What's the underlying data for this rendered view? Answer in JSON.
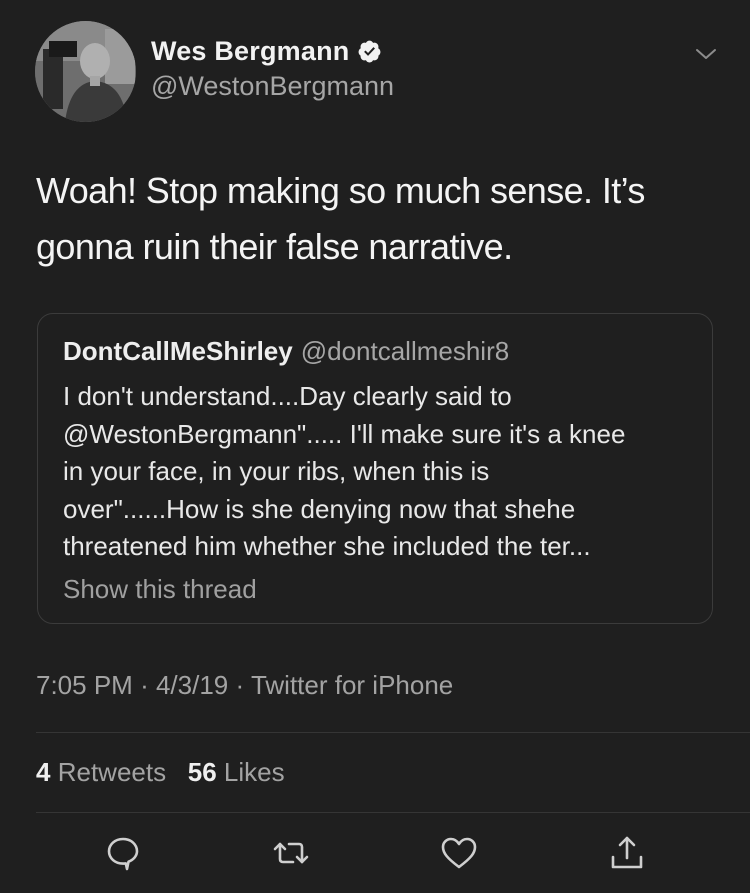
{
  "author": {
    "display_name": "Wes Bergmann",
    "handle": "@WestonBergmann",
    "verified_icon": "verified-badge-icon",
    "avatar_icon": "avatar"
  },
  "tweet": {
    "text": "Woah! Stop making so much sense. It’s gonna ruin their false narrative.",
    "time": "7:05 PM",
    "date": "4/3/19",
    "source": "Twitter for iPhone",
    "separator": "·"
  },
  "quote": {
    "name": "DontCallMeShirley",
    "handle": "@dontcallmeshir8",
    "lines": [
      "I don't understand....Day clearly said to",
      "@WestonBergmann\"..... I'll make sure it's a knee",
      "in your face, in your ribs, when this is",
      "over\"......How is she denying now that shehe",
      "threatened him whether she included the ter..."
    ],
    "show_thread": "Show this thread"
  },
  "stats": {
    "retweets_count": "4",
    "retweets_label": "Retweets",
    "likes_count": "56",
    "likes_label": "Likes"
  },
  "actions": [
    "reply-icon",
    "retweet-icon",
    "like-icon",
    "share-icon"
  ],
  "colors": {
    "background": "#1f1f1f",
    "primary_text": "#f4f4f4",
    "secondary_text": "#a3a3a3",
    "border": "#3b3b3b"
  }
}
